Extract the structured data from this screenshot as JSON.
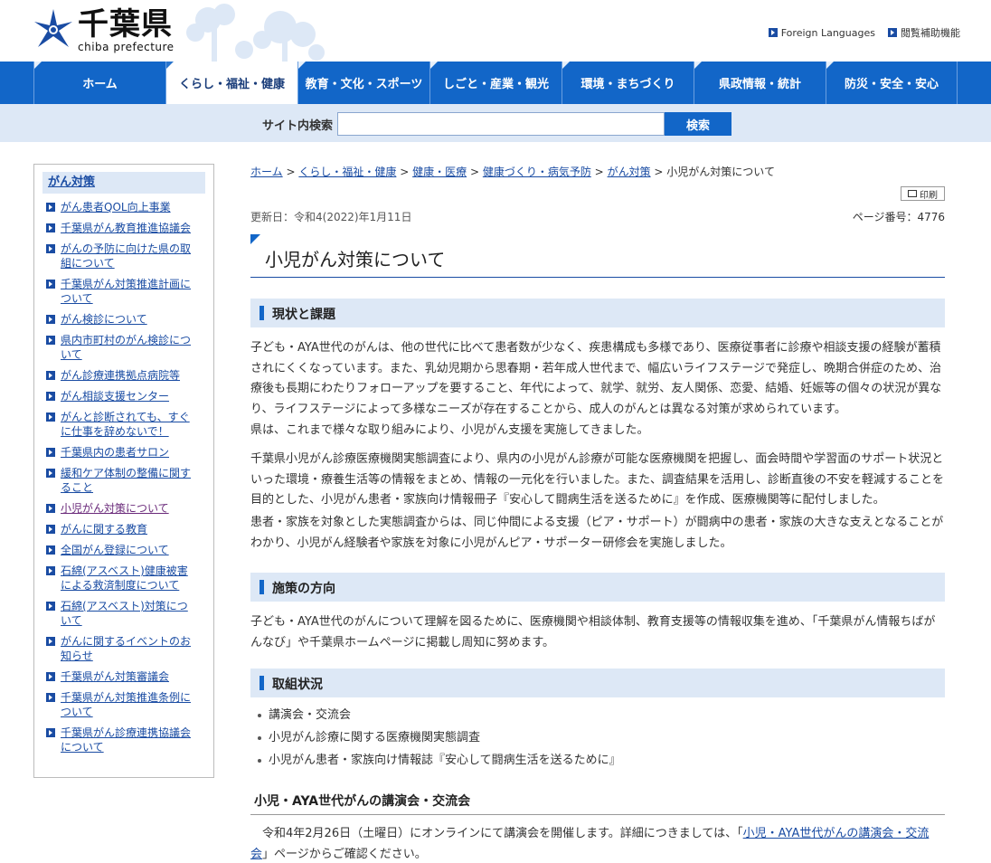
{
  "header": {
    "logo_kanji": "千葉県",
    "logo_roman": "chiba prefecture",
    "links": [
      "Foreign Languages",
      "閲覧補助機能"
    ]
  },
  "gnav": [
    "ホーム",
    "くらし・福祉・健康",
    "教育・文化・スポーツ",
    "しごと・産業・観光",
    "環境・まちづくり",
    "県政情報・統計",
    "防災・安全・安心"
  ],
  "search": {
    "label": "サイト内検索",
    "value": "",
    "button": "検索"
  },
  "sidebar": {
    "heading": "がん対策",
    "items": [
      "がん患者QOL向上事業",
      "千葉県がん教育推進協議会",
      "がんの予防に向けた県の取組について",
      "千葉県がん対策推進計画について",
      "がん検診について",
      "県内市町村のがん検診について",
      "がん診療連携拠点病院等",
      "がん相談支援センター",
      "がんと診断されても、すぐに仕事を辞めないで！",
      "千葉県内の患者サロン",
      "緩和ケア体制の整備に関すること",
      "小児がん対策について",
      "がんに関する教育",
      "全国がん登録について",
      "石綿(アスベスト)健康被害による救済制度について",
      "石綿(アスベスト)対策について",
      "がんに関するイベントのお知らせ",
      "千葉県がん対策審議会",
      "千葉県がん対策推進条例について",
      "千葉県がん診療連携協議会について"
    ]
  },
  "breadcrumb": {
    "links": [
      "ホーム",
      "くらし・福祉・健康",
      "健康・医療",
      "健康づくり・病気予防",
      "がん対策"
    ],
    "separator": ">",
    "current": "小児がん対策について"
  },
  "print_label": "印刷",
  "meta": {
    "updated": "更新日：令和4(2022)年1月11日",
    "page_no": "ページ番号：4776"
  },
  "title": "小児がん対策について",
  "sections": {
    "s1_heading": "現状と課題",
    "s1_p1": "子ども・AYA世代のがんは、他の世代に比べて患者数が少なく、疾患構成も多様であり、医療従事者に診療や相談支援の経験が蓄積されにくくなっています。また、乳幼児期から思春期・若年成人世代まで、幅広いライフステージで発症し、晩期合併症のため、治療後も長期にわたりフォローアップを要すること、年代によって、就学、就労、友人関係、恋愛、結婚、妊娠等の個々の状況が異なり、ライフステージによって多様なニーズが存在することから、成人のがんとは異なる対策が求められています。",
    "s1_p2": "県は、これまで様々な取り組みにより、小児がん支援を実施してきました。",
    "s1_p3": "千葉県小児がん診療医療機関実態調査により、県内の小児がん診療が可能な医療機関を把握し、面会時間や学習面のサポート状況といった環境・療養生活等の情報をまとめ、情報の一元化を行いました。また、調査結果を活用し、診断直後の不安を軽減することを目的とした、小児がん患者・家族向け情報冊子『安心して闘病生活を送るために』を作成、医療機関等に配付しました。",
    "s1_p4": "患者・家族を対象とした実態調査からは、同じ仲間による支援（ピア・サポート）が闘病中の患者・家族の大きな支えとなることがわかり、小児がん経験者や家族を対象に小児がんピア・サポーター研修会を実施しました。",
    "s2_heading": "施策の方向",
    "s2_p1": "子ども・AYA世代のがんについて理解を図るために、医療機関や相談体制、教育支援等の情報収集を進め、「千葉県がん情報ちばがんなび」や千葉県ホームページに掲載し周知に努めます。",
    "s3_heading": "取組状況",
    "s3_items": [
      "講演会・交流会",
      "小児がん診療に関する医療機関実態調査",
      "小児がん患者・家族向け情報誌『安心して闘病生活を送るために』"
    ],
    "s4_heading": "小児・AYA世代がんの講演会・交流会",
    "s4_p_before": "令和4年2月26日（土曜日）にオンラインにて講演会を開催します。詳細につきましては、「",
    "s4_p_link": "小児・AYA世代がんの講演会・交流会",
    "s4_p_after": "」ページからご確認ください。"
  }
}
